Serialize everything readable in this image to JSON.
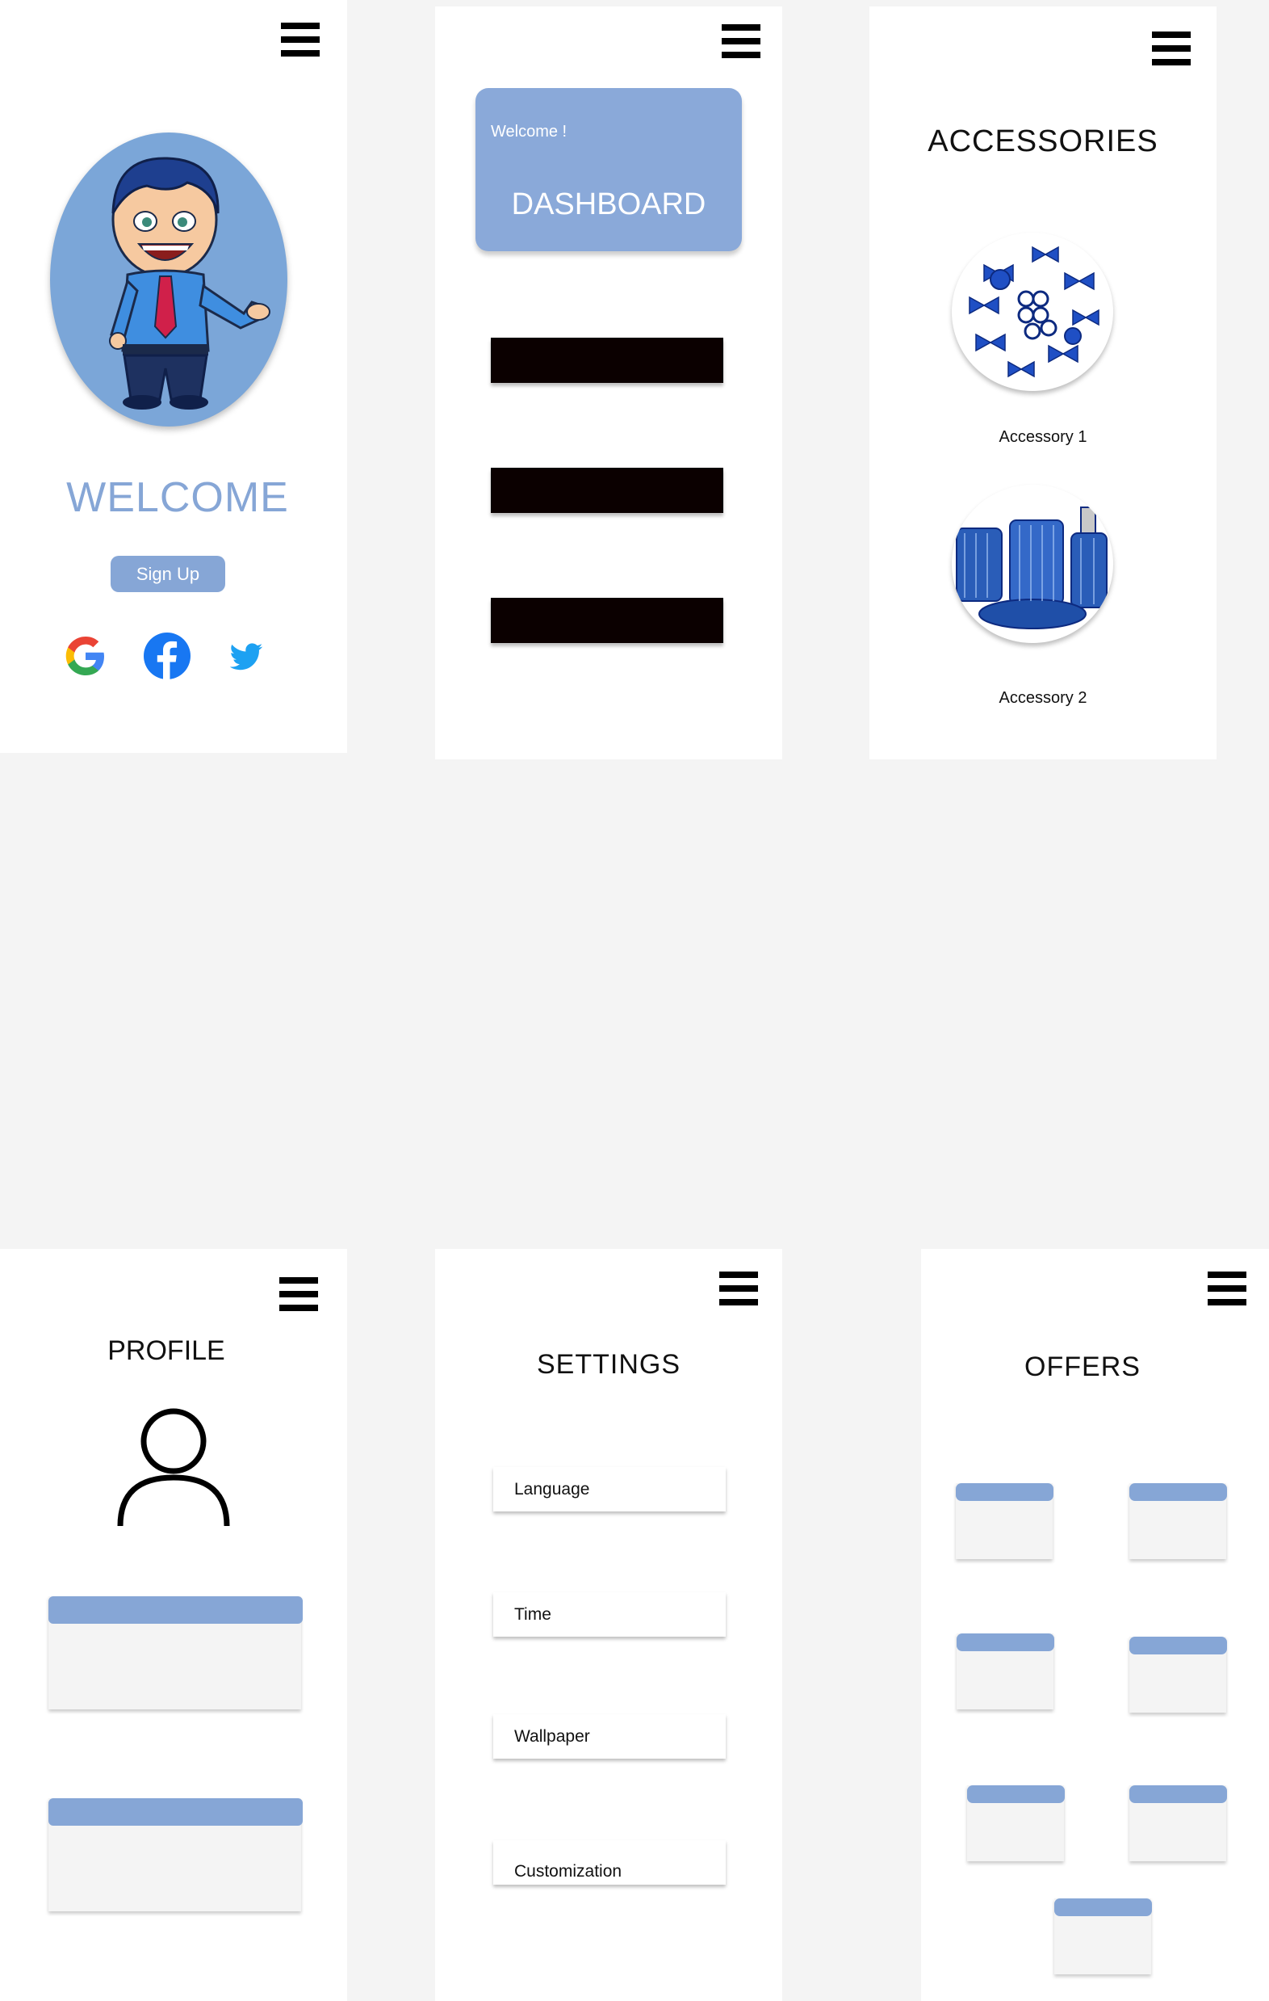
{
  "colors": {
    "accent": "#86a6d6",
    "avatar_bg": "#7ba6d8",
    "dark_bar": "#0b0000",
    "canvas": "#f4f4f4"
  },
  "welcome_screen": {
    "title": "WELCOME",
    "signup_label": "Sign Up",
    "social_icons": [
      "google-icon",
      "facebook-icon",
      "twitter-icon"
    ]
  },
  "dashboard_screen": {
    "greeting": "Welcome !",
    "title": "DASHBOARD"
  },
  "accessories_screen": {
    "title": "ACCESSORIES",
    "items": [
      {
        "label": "Accessory 1"
      },
      {
        "label": "Accessory 2"
      }
    ]
  },
  "profile_screen": {
    "title": "PROFILE"
  },
  "settings_screen": {
    "title": "SETTINGS",
    "items": [
      {
        "label": "Language"
      },
      {
        "label": "Time"
      },
      {
        "label": "Wallpaper"
      },
      {
        "label": "Customization"
      }
    ]
  },
  "offers_screen": {
    "title": "OFFERS"
  }
}
